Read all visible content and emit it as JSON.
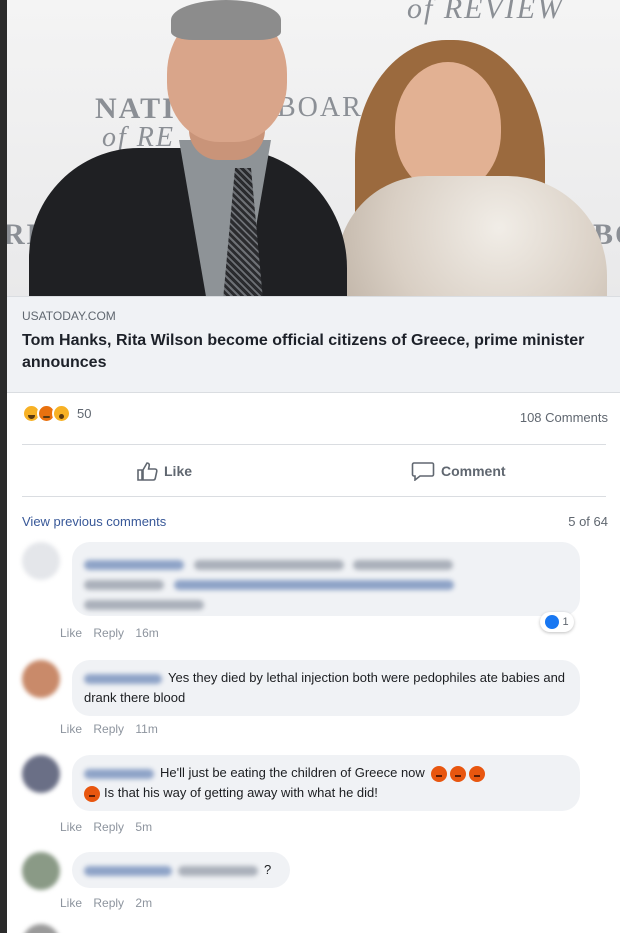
{
  "post": {
    "photo_wall_text": [
      "of REVIEW",
      "NATI",
      "of RE",
      "BOAR",
      "RD",
      "BO"
    ],
    "link_domain": "USATODAY.COM",
    "link_title": "Tom Hanks, Rita Wilson become official citizens of Greece, prime minister announces",
    "reaction_icons": [
      "haha-icon",
      "angry-icon",
      "wow-icon"
    ],
    "reaction_count": "50",
    "comments_count": "108 Comments",
    "like_label": "Like",
    "comment_label": "Comment"
  },
  "comments_section": {
    "view_previous": "View previous comments",
    "page_count": "5 of 64"
  },
  "comments": [
    {
      "text": "",
      "actions": [
        "Like",
        "Reply",
        "16m"
      ],
      "like_badge": "1"
    },
    {
      "text": "Yes they died by lethal injection both were pedophiles ate babies and drank there blood",
      "actions": [
        "Like",
        "Reply",
        "11m"
      ]
    },
    {
      "text_1": "He'll just be eating the children of Greece now",
      "text_2": "Is that his way of getting away with what he did!",
      "actions": [
        "Like",
        "Reply",
        "5m"
      ]
    },
    {
      "text": "?",
      "actions": [
        "Like",
        "Reply",
        "2m"
      ]
    }
  ],
  "colors": {
    "link_blue": "#385898",
    "meta_grey": "#8d949e",
    "bubble_bg": "#f0f2f5",
    "angry_orange": "#e8560f"
  }
}
